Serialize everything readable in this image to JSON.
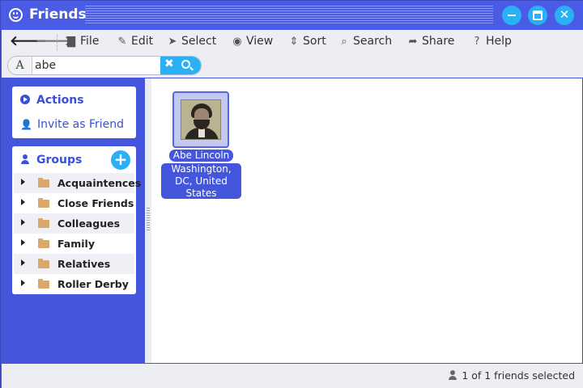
{
  "window": {
    "title": "Friends",
    "accent_color": "#4456dc",
    "button_color": "#29b0f5"
  },
  "toolbar": {
    "back_icon": "arrow-left-icon",
    "forward_icon": "arrow-right-icon",
    "items": [
      {
        "label": "File",
        "icon": "file-icon"
      },
      {
        "label": "Edit",
        "icon": "pencil-icon"
      },
      {
        "label": "Select",
        "icon": "cursor-icon"
      },
      {
        "label": "View",
        "icon": "eye-icon"
      },
      {
        "label": "Sort",
        "icon": "sort-icon"
      },
      {
        "label": "Search",
        "icon": "search-icon"
      },
      {
        "label": "Share",
        "icon": "share-icon"
      },
      {
        "label": "Help",
        "icon": "help-icon"
      }
    ]
  },
  "search": {
    "font_glyph": "A",
    "value": "abe"
  },
  "sidebar": {
    "actions": {
      "title": "Actions",
      "invite_label": "Invite as Friend"
    },
    "groups": {
      "title": "Groups",
      "add_glyph": "+",
      "items": [
        {
          "label": "Acquaintences"
        },
        {
          "label": "Close Friends"
        },
        {
          "label": "Colleagues"
        },
        {
          "label": "Family"
        },
        {
          "label": "Relatives"
        },
        {
          "label": "Roller Derby"
        }
      ]
    }
  },
  "main": {
    "friends": [
      {
        "name": "Abe Lincoln",
        "location": "Washington, DC, United States",
        "selected": true
      }
    ]
  },
  "statusbar": {
    "text": "1 of 1 friends selected"
  }
}
